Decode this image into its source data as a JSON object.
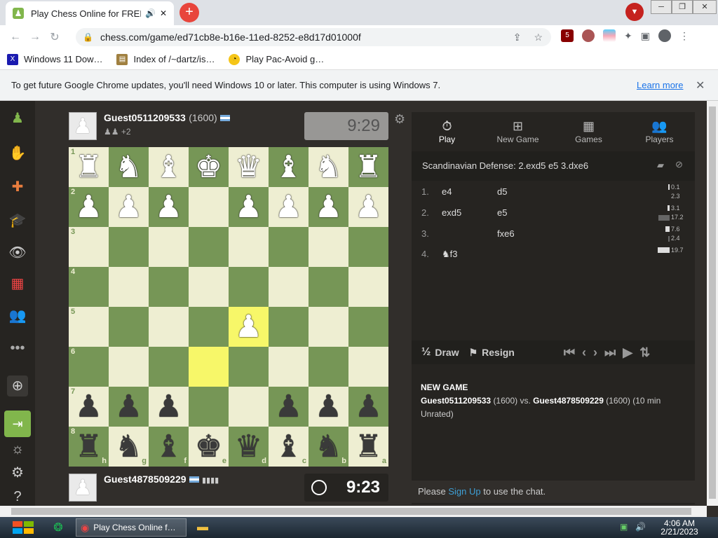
{
  "browser": {
    "tab_title": "Play Chess Online for FREE",
    "url": "chess.com/game/ed71cb8e-b16e-11ed-8252-e8d17d01000f",
    "bookmarks": [
      {
        "label": "Windows 11 Dow…"
      },
      {
        "label": "Index of /~dartz/is…"
      },
      {
        "label": "Play Pac-Avoid g…"
      }
    ],
    "infobar_text": "To get future Google Chrome updates, you'll need Windows 10 or later. This computer is using Windows 7.",
    "infobar_link": "Learn more",
    "ext_badge": "5"
  },
  "top_player": {
    "name": "Guest0511209533",
    "rating": "(1600)",
    "extra": "+2",
    "clock": "9:29"
  },
  "bottom_player": {
    "name": "Guest4878509229",
    "clock": "9:23"
  },
  "board": {
    "ranks": [
      "1",
      "2",
      "3",
      "4",
      "5",
      "6",
      "7",
      "8"
    ],
    "files": [
      "h",
      "g",
      "f",
      "e",
      "d",
      "c",
      "b",
      "a"
    ],
    "rows": [
      [
        "wR",
        "wN",
        "wB",
        "wK",
        "wQ",
        "wB",
        "wN",
        "wR"
      ],
      [
        "wP",
        "wP",
        "wP",
        "",
        "wP",
        "wP",
        "wP",
        "wP"
      ],
      [
        "",
        "",
        "",
        "",
        "",
        "",
        "",
        ""
      ],
      [
        "",
        "",
        "",
        "",
        "",
        "",
        "",
        ""
      ],
      [
        "",
        "",
        "",
        "",
        "wP",
        "",
        "",
        ""
      ],
      [
        "",
        "",
        "",
        "",
        "",
        "",
        "",
        ""
      ],
      [
        "bP",
        "bP",
        "bP",
        "",
        "",
        "bP",
        "bP",
        "bP"
      ],
      [
        "bR",
        "bN",
        "bB",
        "bK",
        "bQ",
        "bB",
        "bN",
        "bR"
      ]
    ],
    "highlights": [
      [
        4,
        4
      ],
      [
        5,
        3
      ]
    ]
  },
  "panel": {
    "tabs": [
      "Play",
      "New Game",
      "Games",
      "Players"
    ],
    "opening": "Scandinavian Defense: 2.exd5 e5 3.dxe6",
    "moves": [
      {
        "num": "1.",
        "white": "e4",
        "black": "d5",
        "ev_top": "0.1",
        "ev_bot": "2.3"
      },
      {
        "num": "2.",
        "white": "exd5",
        "black": "e5",
        "ev_top": "3.1",
        "ev_bot": "17.2"
      },
      {
        "num": "3.",
        "white": "",
        "black": "fxe6",
        "ev_top": "7.6",
        "ev_bot": "2.4"
      },
      {
        "num": "4.",
        "white": "f3",
        "white_piece": "♞",
        "black": "",
        "ev_top": "19.7",
        "ev_bot": ""
      }
    ],
    "draw_label": "Draw",
    "resign_label": "Resign",
    "draw_icon": "½",
    "game_info_heading": "NEW GAME",
    "game_info_white": "Guest0511209533",
    "game_info_white_rating": "(1600) vs.",
    "game_info_black": "Guest4878509229",
    "game_info_tail": "(1600) (10 min Unrated)",
    "chat_pre": "Please",
    "chat_link": "Sign Up",
    "chat_post": "to use the chat."
  },
  "taskbar": {
    "window_label": "Play Chess Online f…",
    "time": "4:06 AM",
    "date": "2/21/2023"
  }
}
